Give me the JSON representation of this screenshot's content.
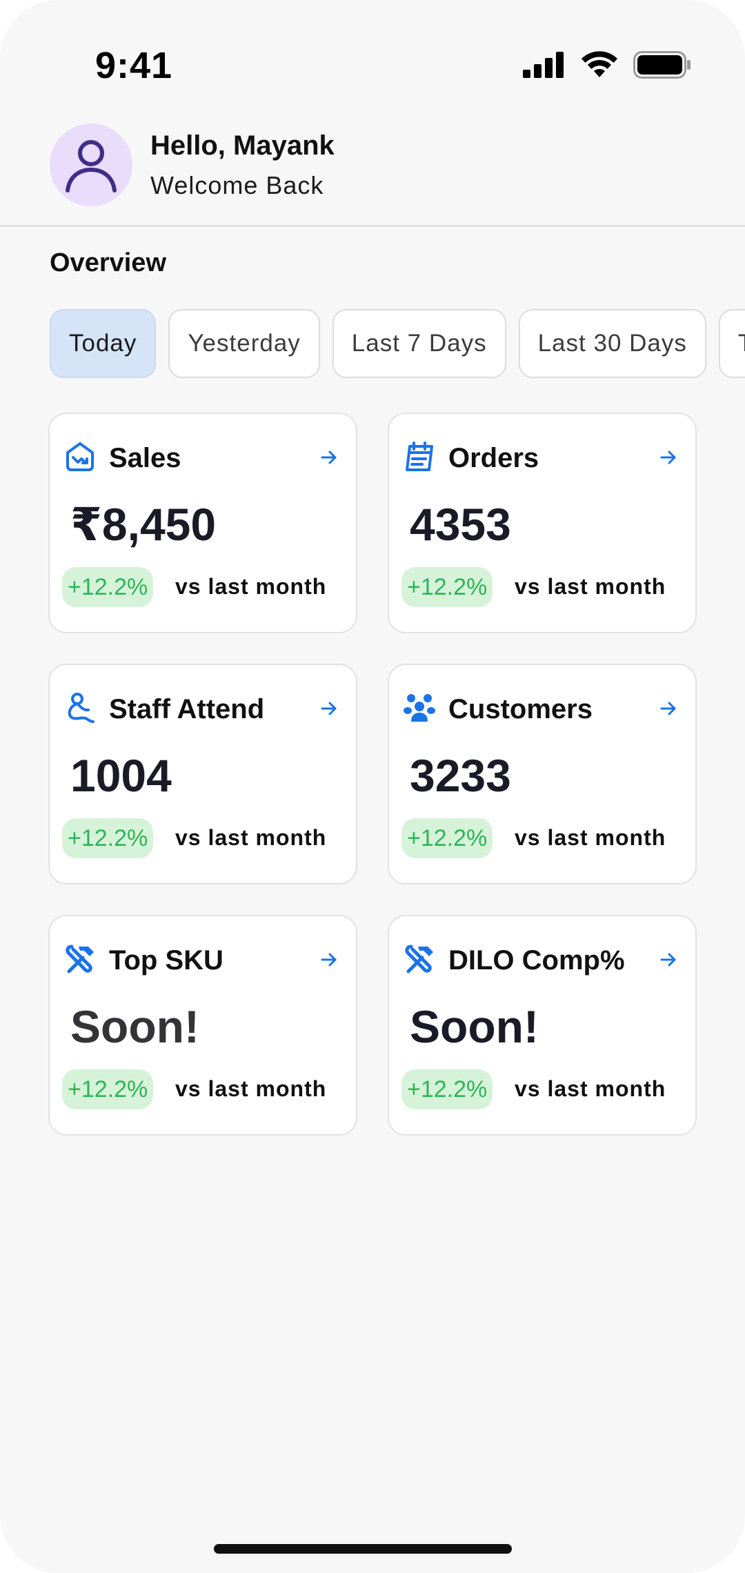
{
  "status_bar": {
    "time": "9:41",
    "icons": [
      "signal-icon",
      "wifi-icon",
      "battery-icon"
    ]
  },
  "header": {
    "greeting": "Hello, Mayank",
    "subtitle": "Welcome Back",
    "avatar_icon": "user-icon"
  },
  "overview": {
    "title": "Overview",
    "filters": [
      "Today",
      "Yesterday",
      "Last 7 Days",
      "Last 30 Days",
      "T"
    ],
    "selected_filter": "Today"
  },
  "cards": [
    {
      "title": "Sales",
      "value": "₹8,450",
      "change": "+12.2%",
      "compare": "vs last month",
      "icon": "sales-icon"
    },
    {
      "title": "Orders",
      "value": "4353",
      "change": "+12.2%",
      "compare": "vs last month",
      "icon": "calendar-icon"
    },
    {
      "title": "Staff Attend",
      "value": "1004",
      "change": "+12.2%",
      "compare": "vs last month",
      "icon": "staff-icon"
    },
    {
      "title": "Customers",
      "value": "3233",
      "change": "+12.2%",
      "compare": "vs last month",
      "icon": "customers-icon"
    },
    {
      "title": "Top SKU",
      "value": "Soon!",
      "change": "+12.2%",
      "compare": "vs last month",
      "icon": "tools-icon"
    },
    {
      "title": "DILO Comp%",
      "value": "Soon!",
      "change": "+12.2%",
      "compare": "vs last month",
      "icon": "tools-icon"
    }
  ],
  "colors": {
    "accent": "#1a73e8",
    "positive_text": "#2fb456",
    "positive_bg": "#d6f3da",
    "chip_active": "#d5e4f7",
    "avatar_bg": "#eadcfb"
  }
}
